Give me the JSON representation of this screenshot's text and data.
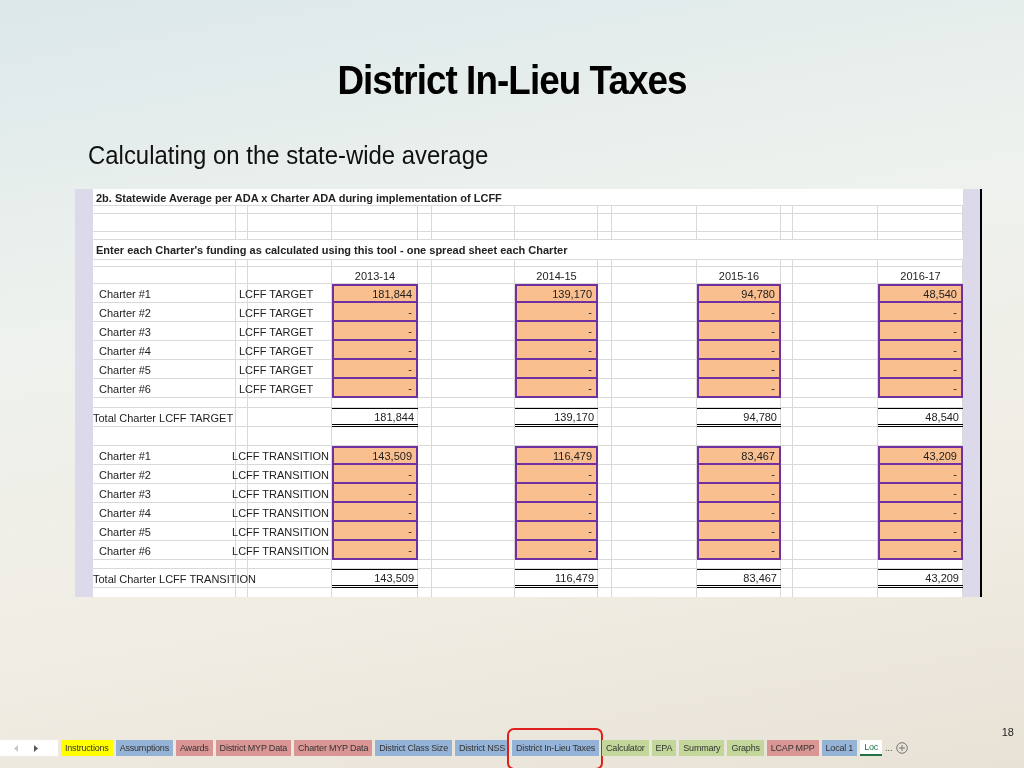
{
  "slide": {
    "title": "District In-Lieu Taxes",
    "subtitle": "Calculating on the state-wide average",
    "page_number": "18"
  },
  "sheet": {
    "heading": "2b. Statewide Average per ADA x Charter ADA during implementation of LCFF",
    "instruction": "Enter each Charter's funding as calculated using this tool - one spread sheet each Charter",
    "years": [
      "2013-14",
      "2014-15",
      "2015-16",
      "2016-17"
    ],
    "sections": [
      {
        "kind": "target",
        "rows": [
          {
            "name": "Charter #1",
            "label": "LCFF TARGET",
            "values": [
              "181,844",
              "139,170",
              "94,780",
              "48,540"
            ]
          },
          {
            "name": "Charter #2",
            "label": "LCFF TARGET",
            "values": [
              "-",
              "-",
              "-",
              "-"
            ]
          },
          {
            "name": "Charter #3",
            "label": "LCFF TARGET",
            "values": [
              "-",
              "-",
              "-",
              "-"
            ]
          },
          {
            "name": "Charter #4",
            "label": "LCFF TARGET",
            "values": [
              "-",
              "-",
              "-",
              "-"
            ]
          },
          {
            "name": "Charter #5",
            "label": "LCFF TARGET",
            "values": [
              "-",
              "-",
              "-",
              "-"
            ]
          },
          {
            "name": "Charter #6",
            "label": "LCFF TARGET",
            "values": [
              "-",
              "-",
              "-",
              "-"
            ]
          }
        ],
        "total": {
          "label": "Total Charter LCFF TARGET",
          "values": [
            "181,844",
            "139,170",
            "94,780",
            "48,540"
          ]
        }
      },
      {
        "kind": "transition",
        "rows": [
          {
            "name": "Charter #1",
            "label": "LCFF TRANSITION",
            "values": [
              "143,509",
              "116,479",
              "83,467",
              "43,209"
            ]
          },
          {
            "name": "Charter #2",
            "label": "LCFF TRANSITION",
            "values": [
              "-",
              "-",
              "-",
              "-"
            ]
          },
          {
            "name": "Charter #3",
            "label": "LCFF TRANSITION",
            "values": [
              "-",
              "-",
              "-",
              "-"
            ]
          },
          {
            "name": "Charter #4",
            "label": "LCFF TRANSITION",
            "values": [
              "-",
              "-",
              "-",
              "-"
            ]
          },
          {
            "name": "Charter #5",
            "label": "LCFF TRANSITION",
            "values": [
              "-",
              "-",
              "-",
              "-"
            ]
          },
          {
            "name": "Charter #6",
            "label": "LCFF TRANSITION",
            "values": [
              "-",
              "-",
              "-",
              "-"
            ]
          }
        ],
        "total": {
          "label": "Total Charter LCFF TRANSITION",
          "values": [
            "143,509",
            "116,479",
            "83,467",
            "43,209"
          ]
        }
      }
    ]
  },
  "tabs": [
    {
      "label": "Instructions",
      "color": "#ffff00",
      "selected": false,
      "highlighted": false
    },
    {
      "label": "Assumptions",
      "color": "#95b3d7",
      "selected": false,
      "highlighted": false
    },
    {
      "label": "Awards",
      "color": "#da9694",
      "selected": false,
      "highlighted": false
    },
    {
      "label": "District MYP Data",
      "color": "#da9694",
      "selected": false,
      "highlighted": false
    },
    {
      "label": "Charter MYP Data",
      "color": "#da9694",
      "selected": false,
      "highlighted": false
    },
    {
      "label": "District Class Size",
      "color": "#95b3d7",
      "selected": false,
      "highlighted": false
    },
    {
      "label": "District NSS",
      "color": "#95b3d7",
      "selected": false,
      "highlighted": false
    },
    {
      "label": "District In-Lieu Taxes",
      "color": "#95b3d7",
      "selected": false,
      "highlighted": true
    },
    {
      "label": "Calculator",
      "color": "#c4d79b",
      "selected": false,
      "highlighted": false
    },
    {
      "label": "EPA",
      "color": "#c4d79b",
      "selected": false,
      "highlighted": false
    },
    {
      "label": "Summary",
      "color": "#c4d79b",
      "selected": false,
      "highlighted": false
    },
    {
      "label": "Graphs",
      "color": "#c4d79b",
      "selected": false,
      "highlighted": false
    },
    {
      "label": "LCAP MPP",
      "color": "#da9694",
      "selected": false,
      "highlighted": false
    },
    {
      "label": "Local 1",
      "color": "#95b3d7",
      "selected": false,
      "highlighted": false
    },
    {
      "label": "Loc",
      "color": "#217346",
      "selected": true,
      "highlighted": false
    }
  ],
  "tab_overflow": "..."
}
